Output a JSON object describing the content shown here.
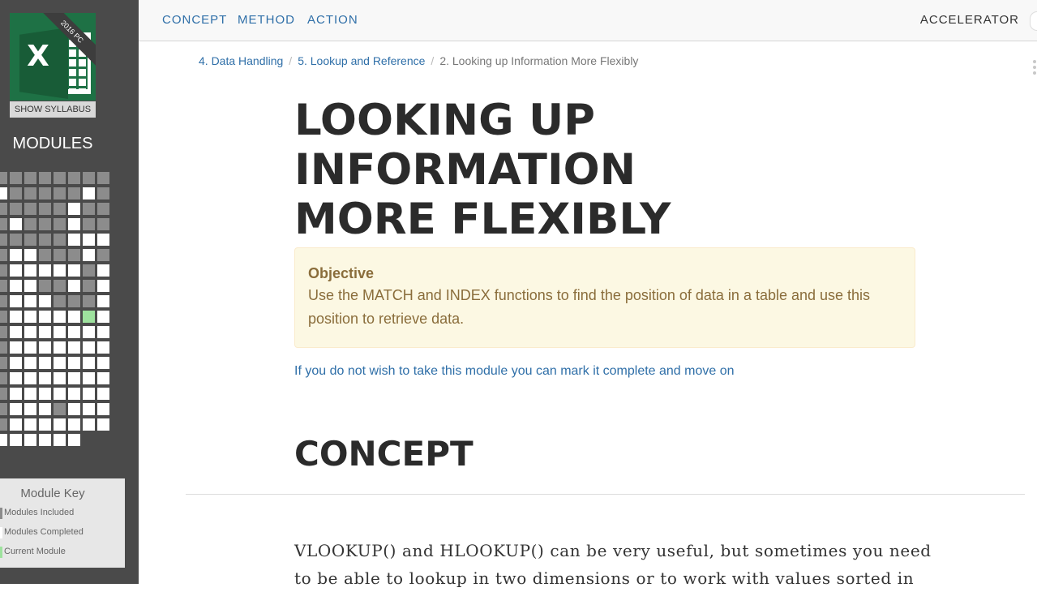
{
  "sidebar": {
    "logo_badge": "2016 PC",
    "logo_letter": "X",
    "show_syllabus": "SHOW SYLLABUS",
    "modules_title": "MODULES",
    "grid_rows": [
      "iiiiiiii",
      "ciiiiici",
      "iiiiicii",
      "iciiicii",
      "iiiiiccc",
      "icciiici",
      "icccccic",
      "icciicic",
      "iccciiic",
      "icccccuc",
      "iccccccc",
      "iccccccc",
      "iccccccc",
      "iccccccc",
      "iccccccc",
      "icccicccc",
      "iccccccc",
      "cccccc--"
    ],
    "module_key": {
      "title": "Module Key",
      "items": [
        {
          "label": "Modules Included",
          "color": "#8c8c8c"
        },
        {
          "label": "Modules Completed",
          "color": "#ffffff"
        },
        {
          "label": "Current Module",
          "color": "#9ee29e"
        }
      ]
    }
  },
  "nav": {
    "concept": "CONCEPT",
    "method": "METHOD",
    "action": "ACTION",
    "accelerator": "ACCELERATOR"
  },
  "breadcrumb": {
    "level1": "4. Data Handling",
    "level2": "5. Lookup and Reference",
    "current": "2. Looking up Information More Flexibly"
  },
  "page": {
    "title_line1": "LOOKING UP INFORMATION",
    "title_line2": "MORE FLEXIBLY",
    "objective_label": "Objective",
    "objective_text": "Use the MATCH and INDEX functions to find the position of data in a table and use this position to retrieve data.",
    "skip_link": "If you do not wish to take this module you can mark it complete and move on",
    "concept_heading": "CONCEPT",
    "body_line1": "VLOOKUP() and HLOOKUP() can be very useful, but sometimes you need",
    "body_line2": "to be able to lookup in two dimensions or to work with values sorted in"
  }
}
